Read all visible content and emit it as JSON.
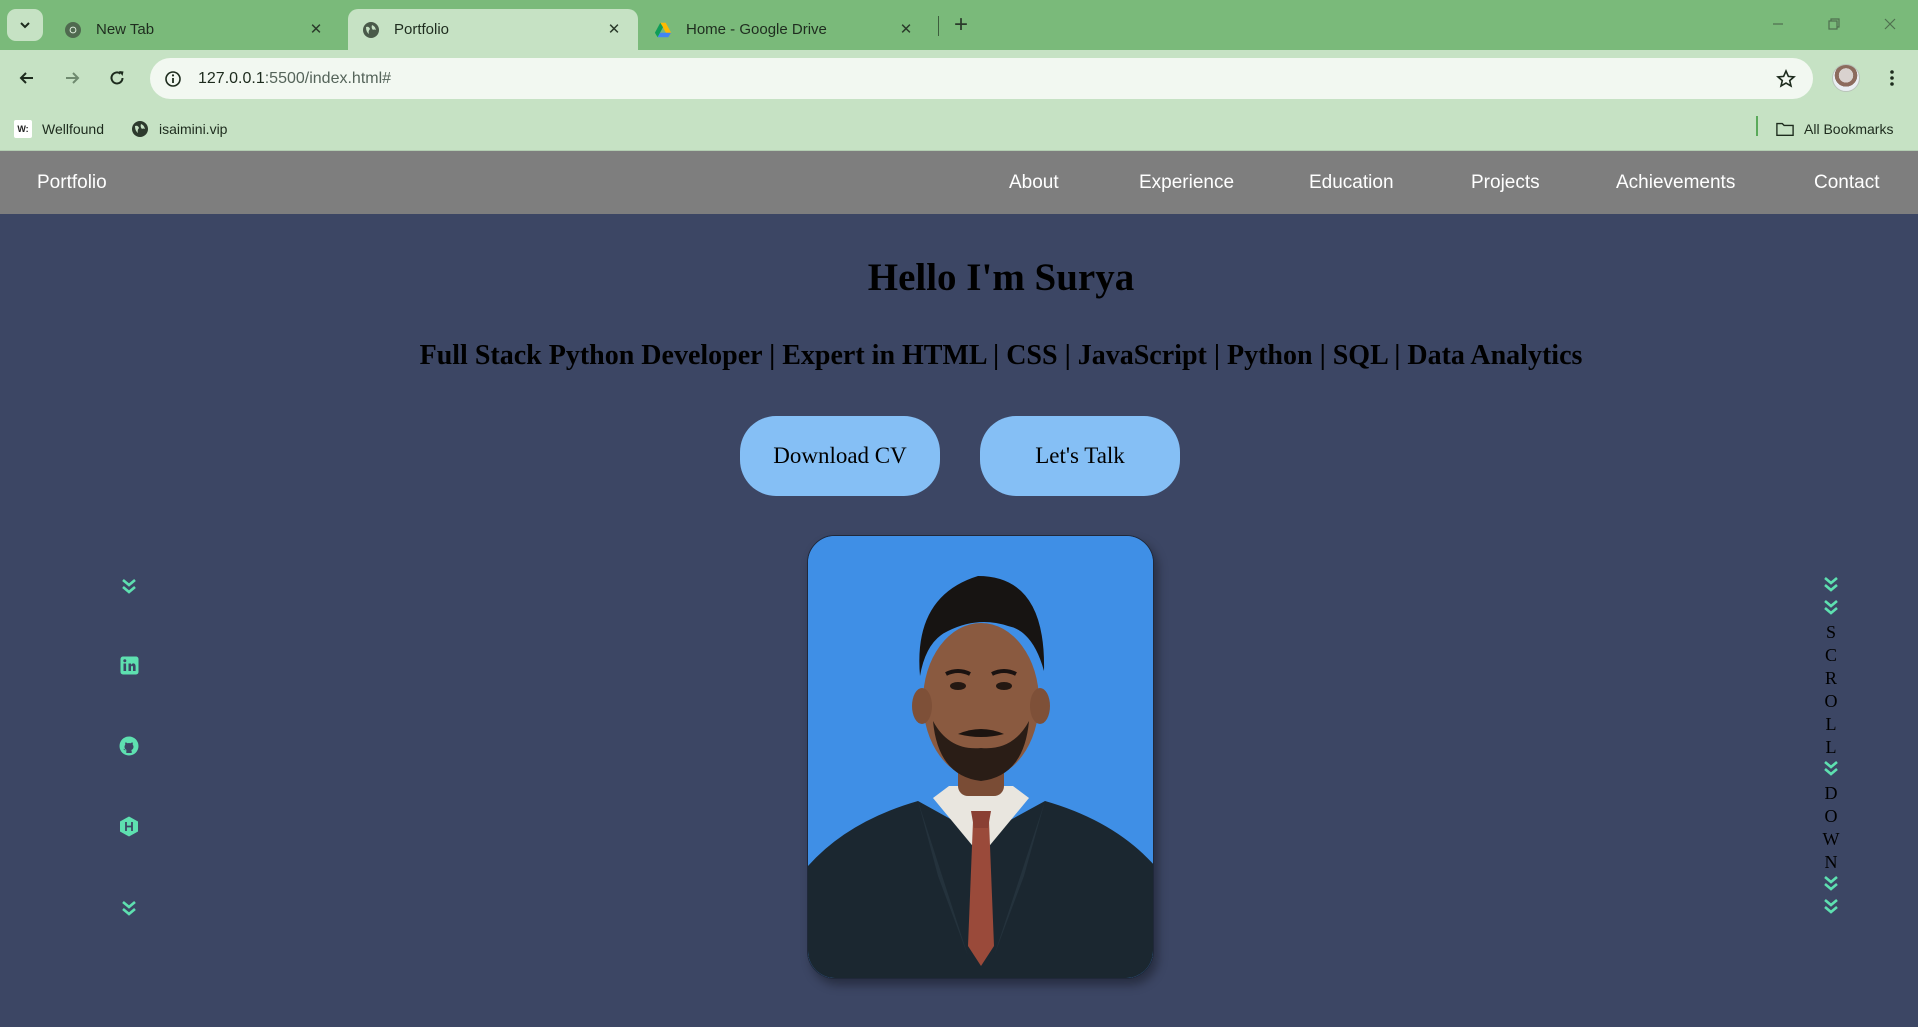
{
  "browser": {
    "tabs": [
      {
        "title": "New Tab",
        "icon": "chrome-icon",
        "active": false
      },
      {
        "title": "Portfolio",
        "icon": "globe-icon",
        "active": true
      },
      {
        "title": "Home - Google Drive",
        "icon": "google-drive-icon",
        "active": false
      }
    ],
    "new_tab_symbol": "+",
    "url_host": "127.0.0.1",
    "url_rest": ":5500/index.html#",
    "bookmarks": [
      {
        "label": "Wellfound",
        "icon": "wellfound-icon",
        "icon_text": "W:"
      },
      {
        "label": "isaimini.vip",
        "icon": "globe-icon"
      }
    ],
    "all_bookmarks": "All Bookmarks"
  },
  "site": {
    "brand": "Portfolio",
    "menu": [
      "About",
      "Experience",
      "Education",
      "Projects",
      "Achievements",
      "Contact"
    ],
    "hero_title": "Hello I'm Surya",
    "hero_subtitle": "Full Stack Python Developer | Expert in HTML | CSS | JavaScript | Python | SQL | Data Analytics",
    "buttons": {
      "download_cv": "Download CV",
      "lets_talk": "Let's Talk"
    },
    "social_icons": [
      "chevron-double-down-icon",
      "linkedin-icon",
      "github-icon",
      "hackerrank-icon",
      "chevron-double-down-icon"
    ],
    "scroll_text": [
      "S",
      "C",
      "R",
      "O",
      "L",
      "L",
      "D",
      "O",
      "W",
      "N"
    ],
    "colors": {
      "page_bg": "#3c4664",
      "nav_bg": "#7e7e7e",
      "button_bg": "#85bff5",
      "accent_icon": "#5ee0b0",
      "photo_bg": "#3f8fe6"
    }
  }
}
